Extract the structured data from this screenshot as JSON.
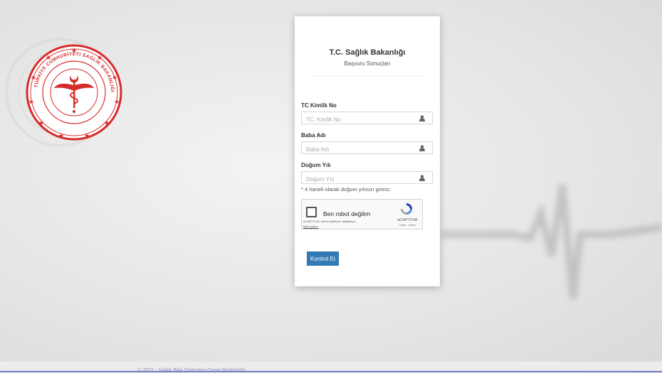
{
  "header": {
    "title": "T.C. Sağlık Bakanlığı",
    "subtitle": "Başvuru Sonuçları"
  },
  "logo": {
    "icon": "ministry-of-health-seal-icon",
    "text": "TÜRKİYE CUMHURİYETİ SAĞLIK BAKANLIĞI",
    "color": "#d62b2b"
  },
  "form": {
    "tc": {
      "label": "TC Kimlik No",
      "placeholder": "TC. Kimlik No",
      "value": ""
    },
    "father": {
      "label": "Baba Adı",
      "placeholder": "Baba Adı",
      "value": ""
    },
    "birth": {
      "label": "Doğum Yılı",
      "placeholder": "Doğum Yılı",
      "value": ""
    },
    "birth_hint": "* 4 haneli olarak doğum yılınızı giriniz.",
    "field_icon": "user-icon"
  },
  "captcha": {
    "label": "Ben robot değilim",
    "notice": "reCAPTCHA, hizmet şartlarını değiştiriyor.",
    "link": "İşlem yapın.",
    "brand": "reCAPTCHA",
    "terms": "Gizlilik - Şartlar"
  },
  "button": {
    "label": "Kontrol Et",
    "color": "#337ab7"
  },
  "footer": {
    "text": "© 2022 - Sağlık Bilgi Sistemleri Genel Müdürlüğü"
  }
}
